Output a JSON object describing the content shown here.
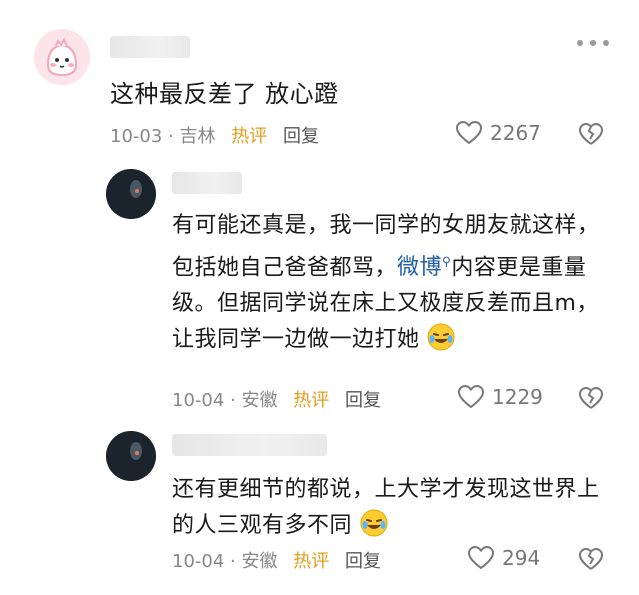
{
  "comments": [
    {
      "text": "这种最反差了 放心蹬",
      "date": "10-03",
      "location": "吉林",
      "hot_label": "热评",
      "reply_label": "回复",
      "likes": "2267"
    },
    {
      "text_before": "有可能还真是，我一同学的女朋友就这样，包括她自己爸爸都骂，",
      "link_text": "微博",
      "text_after": "内容更是重量级。但据同学说在床上又极度反差而且m，让我同学一边做一边打她",
      "date": "10-04",
      "location": "安徽",
      "hot_label": "热评",
      "reply_label": "回复",
      "likes": "1229"
    },
    {
      "text": "还有更细节的都说，上大学才发现这世界上的人三观有多不同",
      "date": "10-04",
      "location": "安徽",
      "hot_label": "热评",
      "reply_label": "回复",
      "likes": "294"
    }
  ],
  "icons": {
    "more": "more-dots-icon",
    "like": "heart-outline-icon",
    "dislike": "broken-heart-icon",
    "emoji": "laughing-crying-face-icon",
    "link_marker": "search-magnifier-icon"
  },
  "colors": {
    "hot_label": "#e89a1a",
    "link": "#1f5ea8",
    "meta": "#888888"
  }
}
